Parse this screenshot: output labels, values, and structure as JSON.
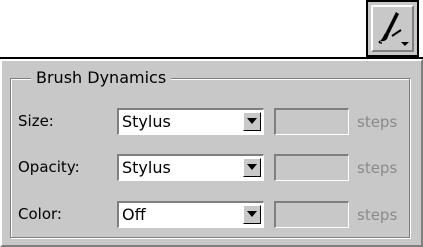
{
  "toolbar": {
    "brush_icon": "brush-dropdown-icon"
  },
  "panel": {
    "title": "Brush Dynamics",
    "rows": [
      {
        "label": "Size:",
        "value": "Stylus",
        "steps_value": "",
        "steps_label": "steps"
      },
      {
        "label": "Opacity:",
        "value": "Stylus",
        "steps_value": "",
        "steps_label": "steps"
      },
      {
        "label": "Color:",
        "value": "Off",
        "steps_value": "",
        "steps_label": "steps"
      }
    ]
  },
  "colors": {
    "panel_bg": "#c8c8c8",
    "disabled_text": "#8a8a8a"
  }
}
